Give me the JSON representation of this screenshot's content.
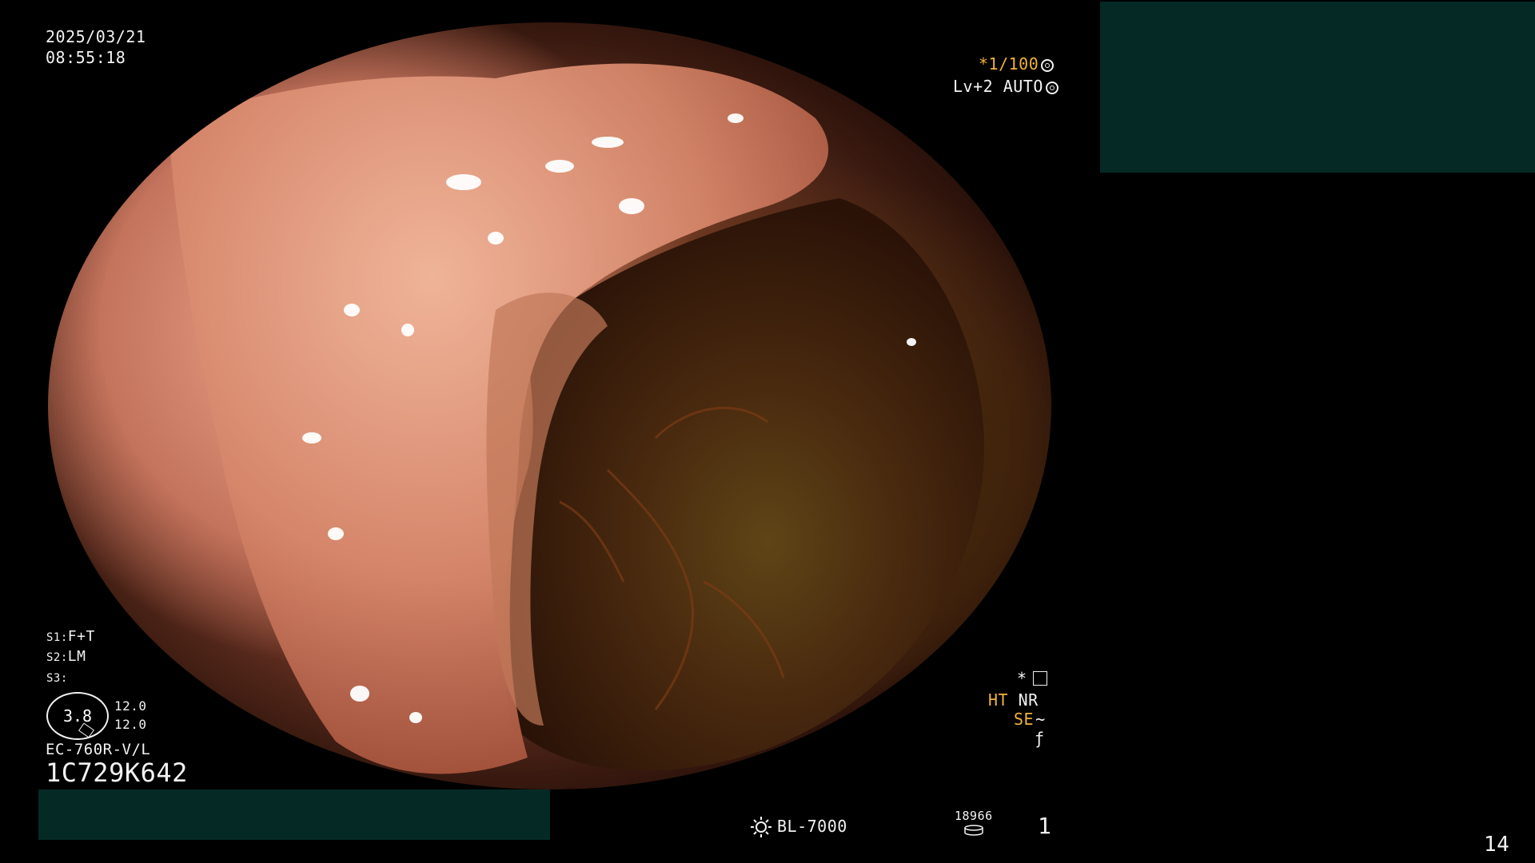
{
  "overlay": {
    "date": "2025/03/21",
    "time": "08:55:18",
    "shutter": "*1/100",
    "exposure_level": "Lv+2",
    "exposure_mode": "AUTO",
    "scope_settings": {
      "s1": "F+T",
      "s2": "LM",
      "s3": ""
    },
    "gauge_value": "3.8",
    "gauge_scale_top": "12.0",
    "gauge_scale_bottom": "12.0",
    "scope_model": "EC-760R-V/L",
    "serial_number": "1C729K642",
    "mode_star": "*",
    "ht_label": "HT",
    "nr_label": "NR",
    "se_label": "SE",
    "light_source": "BL-7000",
    "storage_count": "18966",
    "image_count": "1",
    "page_number": "14"
  },
  "colors": {
    "accent_amber": "#f0b23a",
    "panel_teal": "#052a26",
    "overlay_text": "#f2f2f2"
  }
}
